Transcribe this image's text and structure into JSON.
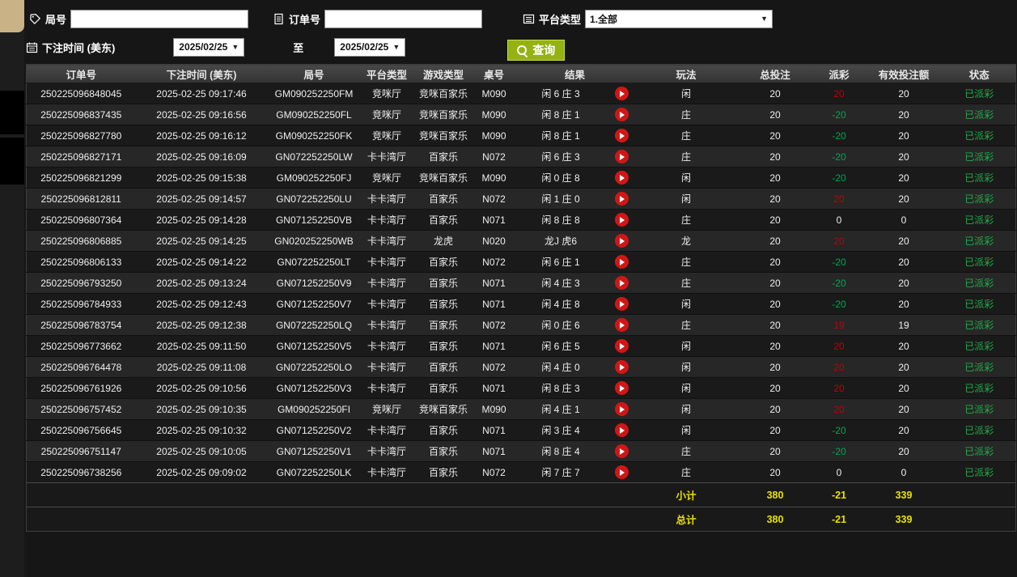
{
  "filters": {
    "round": {
      "label": "局号",
      "value": ""
    },
    "order": {
      "label": "订单号",
      "value": ""
    },
    "platform": {
      "label": "平台类型",
      "selected": "1.全部"
    },
    "bet_time": {
      "label": "下注时间 (美东)",
      "from": "2025/02/25",
      "to_separator": "至",
      "to": "2025/02/25"
    },
    "query_button": "查询"
  },
  "icons": {
    "round": "tag-icon",
    "order": "document-icon",
    "platform": "list-icon",
    "bet_time": "calendar-icon",
    "query": "magnifier-icon",
    "replay": "play-icon",
    "dropdown_caret": "▼"
  },
  "colors": {
    "query_button_bg": "#94b212",
    "payout_win_red": "#c00000",
    "payout_loss_green": "#00a651",
    "status_paid_green": "#23aa4a",
    "totals_yellow": "#e8e000",
    "sidebar_tab_tan": "#c9b286",
    "replay_red": "#d11616"
  },
  "table": {
    "headers": [
      "订单号",
      "下注时间 (美东)",
      "局号",
      "平台类型",
      "游戏类型",
      "桌号",
      "结果",
      "玩法",
      "总投注",
      "派彩",
      "有效投注额",
      "状态"
    ],
    "rows": [
      {
        "order_id": "250225096848045",
        "bet_time": "2025-02-25 09:17:46",
        "round_id": "GM090252250FM",
        "platform": "竞咪厅",
        "game_type": "竞咪百家乐",
        "table_no": "M090",
        "result": "闲 6 庄 3",
        "play": "闲",
        "total_bet": "20",
        "payout": "20",
        "valid_bet": "20",
        "status": "已派彩"
      },
      {
        "order_id": "250225096837435",
        "bet_time": "2025-02-25 09:16:56",
        "round_id": "GM090252250FL",
        "platform": "竞咪厅",
        "game_type": "竞咪百家乐",
        "table_no": "M090",
        "result": "闲 8 庄 1",
        "play": "庄",
        "total_bet": "20",
        "payout": "-20",
        "valid_bet": "20",
        "status": "已派彩"
      },
      {
        "order_id": "250225096827780",
        "bet_time": "2025-02-25 09:16:12",
        "round_id": "GM090252250FK",
        "platform": "竞咪厅",
        "game_type": "竞咪百家乐",
        "table_no": "M090",
        "result": "闲 8 庄 1",
        "play": "庄",
        "total_bet": "20",
        "payout": "-20",
        "valid_bet": "20",
        "status": "已派彩"
      },
      {
        "order_id": "250225096827171",
        "bet_time": "2025-02-25 09:16:09",
        "round_id": "GN072252250LW",
        "platform": "卡卡湾厅",
        "game_type": "百家乐",
        "table_no": "N072",
        "result": "闲 6 庄 3",
        "play": "庄",
        "total_bet": "20",
        "payout": "-20",
        "valid_bet": "20",
        "status": "已派彩"
      },
      {
        "order_id": "250225096821299",
        "bet_time": "2025-02-25 09:15:38",
        "round_id": "GM090252250FJ",
        "platform": "竞咪厅",
        "game_type": "竞咪百家乐",
        "table_no": "M090",
        "result": "闲 0 庄 8",
        "play": "闲",
        "total_bet": "20",
        "payout": "-20",
        "valid_bet": "20",
        "status": "已派彩"
      },
      {
        "order_id": "250225096812811",
        "bet_time": "2025-02-25 09:14:57",
        "round_id": "GN072252250LU",
        "platform": "卡卡湾厅",
        "game_type": "百家乐",
        "table_no": "N072",
        "result": "闲 1 庄 0",
        "play": "闲",
        "total_bet": "20",
        "payout": "20",
        "valid_bet": "20",
        "status": "已派彩"
      },
      {
        "order_id": "250225096807364",
        "bet_time": "2025-02-25 09:14:28",
        "round_id": "GN071252250VB",
        "platform": "卡卡湾厅",
        "game_type": "百家乐",
        "table_no": "N071",
        "result": "闲 8 庄 8",
        "play": "庄",
        "total_bet": "20",
        "payout": "0",
        "valid_bet": "0",
        "status": "已派彩"
      },
      {
        "order_id": "250225096806885",
        "bet_time": "2025-02-25 09:14:25",
        "round_id": "GN020252250WB",
        "platform": "卡卡湾厅",
        "game_type": "龙虎",
        "table_no": "N020",
        "result": "龙J 虎6",
        "play": "龙",
        "total_bet": "20",
        "payout": "20",
        "valid_bet": "20",
        "status": "已派彩"
      },
      {
        "order_id": "250225096806133",
        "bet_time": "2025-02-25 09:14:22",
        "round_id": "GN072252250LT",
        "platform": "卡卡湾厅",
        "game_type": "百家乐",
        "table_no": "N072",
        "result": "闲 6 庄 1",
        "play": "庄",
        "total_bet": "20",
        "payout": "-20",
        "valid_bet": "20",
        "status": "已派彩"
      },
      {
        "order_id": "250225096793250",
        "bet_time": "2025-02-25 09:13:24",
        "round_id": "GN071252250V9",
        "platform": "卡卡湾厅",
        "game_type": "百家乐",
        "table_no": "N071",
        "result": "闲 4 庄 3",
        "play": "庄",
        "total_bet": "20",
        "payout": "-20",
        "valid_bet": "20",
        "status": "已派彩"
      },
      {
        "order_id": "250225096784933",
        "bet_time": "2025-02-25 09:12:43",
        "round_id": "GN071252250V7",
        "platform": "卡卡湾厅",
        "game_type": "百家乐",
        "table_no": "N071",
        "result": "闲 4 庄 8",
        "play": "闲",
        "total_bet": "20",
        "payout": "-20",
        "valid_bet": "20",
        "status": "已派彩"
      },
      {
        "order_id": "250225096783754",
        "bet_time": "2025-02-25 09:12:38",
        "round_id": "GN072252250LQ",
        "platform": "卡卡湾厅",
        "game_type": "百家乐",
        "table_no": "N072",
        "result": "闲 0 庄 6",
        "play": "庄",
        "total_bet": "20",
        "payout": "19",
        "valid_bet": "19",
        "status": "已派彩"
      },
      {
        "order_id": "250225096773662",
        "bet_time": "2025-02-25 09:11:50",
        "round_id": "GN071252250V5",
        "platform": "卡卡湾厅",
        "game_type": "百家乐",
        "table_no": "N071",
        "result": "闲 6 庄 5",
        "play": "闲",
        "total_bet": "20",
        "payout": "20",
        "valid_bet": "20",
        "status": "已派彩"
      },
      {
        "order_id": "250225096764478",
        "bet_time": "2025-02-25 09:11:08",
        "round_id": "GN072252250LO",
        "platform": "卡卡湾厅",
        "game_type": "百家乐",
        "table_no": "N072",
        "result": "闲 4 庄 0",
        "play": "闲",
        "total_bet": "20",
        "payout": "20",
        "valid_bet": "20",
        "status": "已派彩"
      },
      {
        "order_id": "250225096761926",
        "bet_time": "2025-02-25 09:10:56",
        "round_id": "GN071252250V3",
        "platform": "卡卡湾厅",
        "game_type": "百家乐",
        "table_no": "N071",
        "result": "闲 8 庄 3",
        "play": "闲",
        "total_bet": "20",
        "payout": "20",
        "valid_bet": "20",
        "status": "已派彩"
      },
      {
        "order_id": "250225096757452",
        "bet_time": "2025-02-25 09:10:35",
        "round_id": "GM090252250FI",
        "platform": "竞咪厅",
        "game_type": "竞咪百家乐",
        "table_no": "M090",
        "result": "闲 4 庄 1",
        "play": "闲",
        "total_bet": "20",
        "payout": "20",
        "valid_bet": "20",
        "status": "已派彩"
      },
      {
        "order_id": "250225096756645",
        "bet_time": "2025-02-25 09:10:32",
        "round_id": "GN071252250V2",
        "platform": "卡卡湾厅",
        "game_type": "百家乐",
        "table_no": "N071",
        "result": "闲 3 庄 4",
        "play": "闲",
        "total_bet": "20",
        "payout": "-20",
        "valid_bet": "20",
        "status": "已派彩"
      },
      {
        "order_id": "250225096751147",
        "bet_time": "2025-02-25 09:10:05",
        "round_id": "GN071252250V1",
        "platform": "卡卡湾厅",
        "game_type": "百家乐",
        "table_no": "N071",
        "result": "闲 8 庄 4",
        "play": "庄",
        "total_bet": "20",
        "payout": "-20",
        "valid_bet": "20",
        "status": "已派彩"
      },
      {
        "order_id": "250225096738256",
        "bet_time": "2025-02-25 09:09:02",
        "round_id": "GN072252250LK",
        "platform": "卡卡湾厅",
        "game_type": "百家乐",
        "table_no": "N072",
        "result": "闲 7 庄 7",
        "play": "庄",
        "total_bet": "20",
        "payout": "0",
        "valid_bet": "0",
        "status": "已派彩"
      }
    ],
    "subtotal": {
      "label": "小计",
      "total_bet": "380",
      "payout": "-21",
      "valid_bet": "339"
    },
    "total": {
      "label": "总计",
      "total_bet": "380",
      "payout": "-21",
      "valid_bet": "339"
    }
  }
}
